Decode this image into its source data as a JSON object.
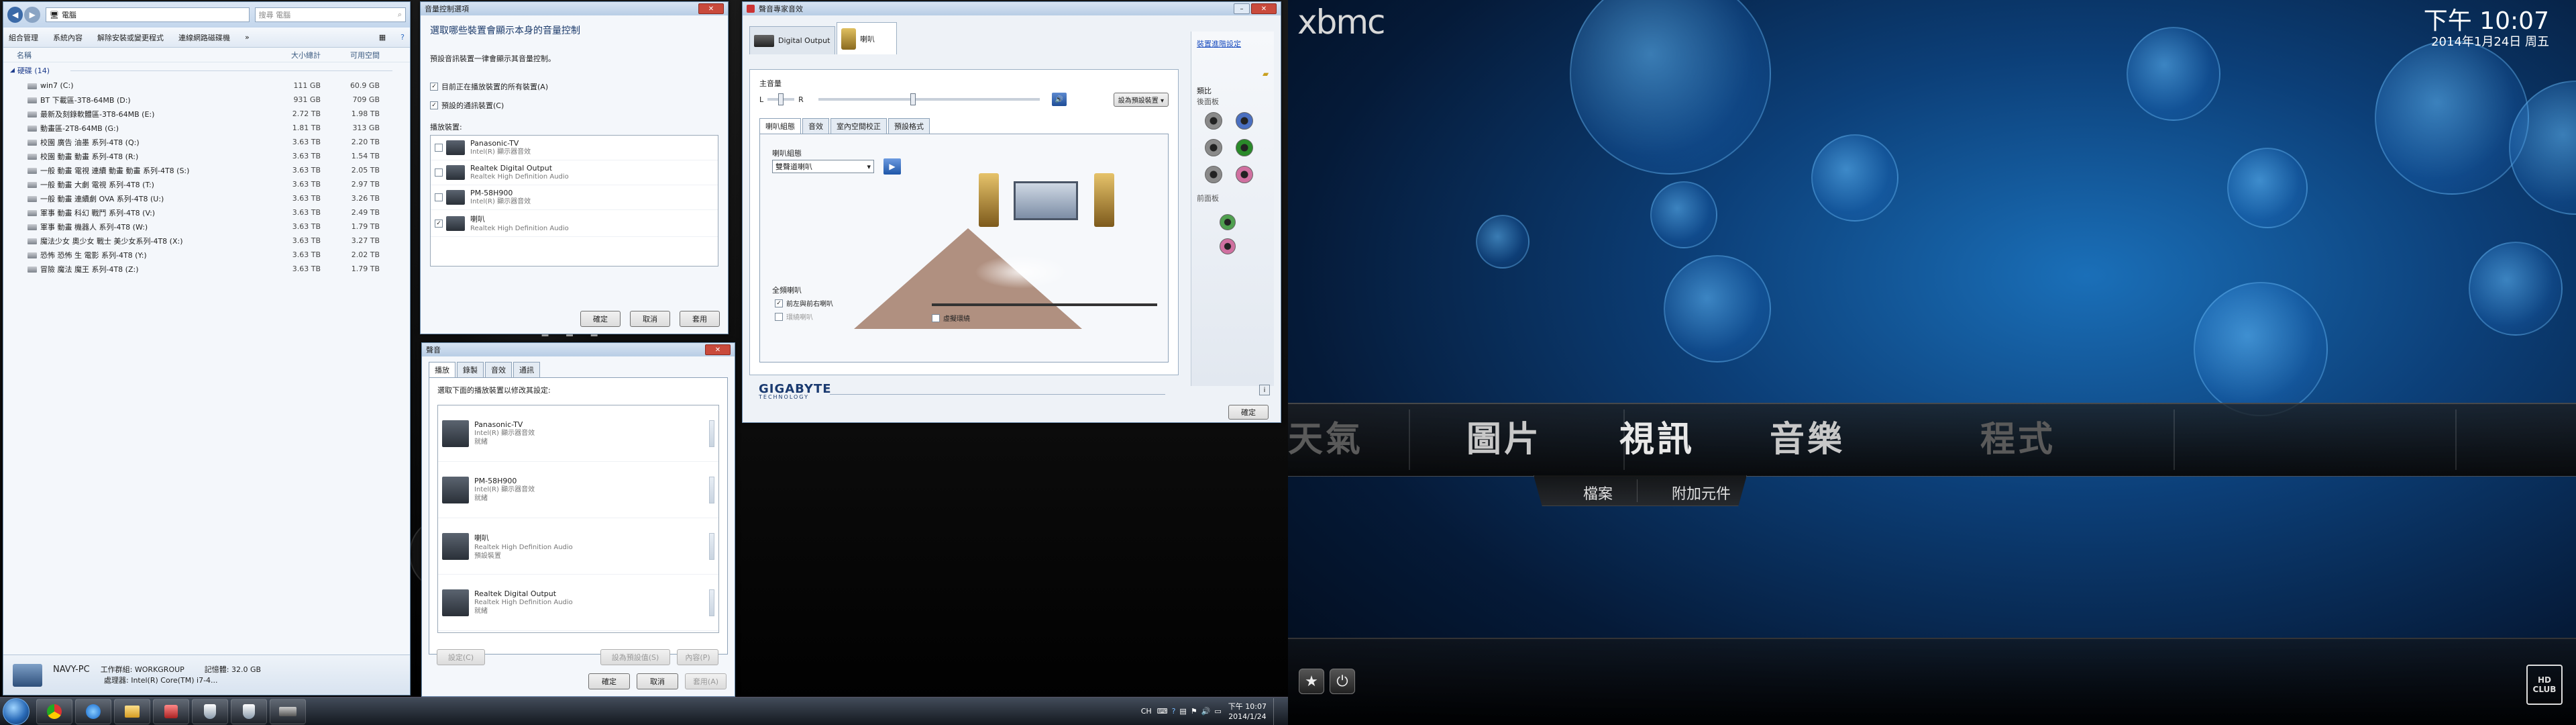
{
  "explorer": {
    "address": "電腦",
    "search_placeholder": "搜尋 電腦",
    "toolbar": [
      "組合管理",
      "系統內容",
      "解除安裝或變更程式",
      "連線網路磁碟機",
      "»"
    ],
    "columns": [
      "名稱",
      "大小總計",
      "可用空間"
    ],
    "group": "硬碟 (14)",
    "drives": [
      {
        "name": "win7 (C:)",
        "total": "111 GB",
        "free": "60.9 GB"
      },
      {
        "name": "BT 下載區-3T8-64MB (D:)",
        "total": "931 GB",
        "free": "709 GB"
      },
      {
        "name": "最新及刻錄軟體區-3T8-64MB (E:)",
        "total": "2.72 TB",
        "free": "1.98 TB"
      },
      {
        "name": "動畫區-2T8-64MB (G:)",
        "total": "1.81 TB",
        "free": "313 GB"
      },
      {
        "name": "校園 廣告 油墨 系列-4T8 (Q:)",
        "total": "3.63 TB",
        "free": "2.20 TB"
      },
      {
        "name": "校園 動畫 動畫 系列-4T8 (R:)",
        "total": "3.63 TB",
        "free": "1.54 TB"
      },
      {
        "name": "一般 動畫 電視 連續 動畫 動畫 系列-4T8 (S:)",
        "total": "3.63 TB",
        "free": "2.05 TB"
      },
      {
        "name": "一般 動畫 大劇 電視 系列-4T8 (T:)",
        "total": "3.63 TB",
        "free": "2.97 TB"
      },
      {
        "name": "一般 動畫 連續劇 OVA 系列-4T8 (U:)",
        "total": "3.63 TB",
        "free": "3.26 TB"
      },
      {
        "name": "軍事 動畫 科幻 戰鬥 系列-4T8 (V:)",
        "total": "3.63 TB",
        "free": "2.49 TB"
      },
      {
        "name": "軍事 動畫 機器人 系列-4T8 (W:)",
        "total": "3.63 TB",
        "free": "1.79 TB"
      },
      {
        "name": "魔法少女 奧少女 戰士 美少女系列-4T8 (X:)",
        "total": "3.63 TB",
        "free": "3.27 TB"
      },
      {
        "name": "恐怖 恐怖 生 電影 系列-4T8 (Y:)",
        "total": "3.63 TB",
        "free": "2.02 TB"
      },
      {
        "name": "冒險 魔法 魔王 系列-4T8 (Z:)",
        "total": "3.63 TB",
        "free": "1.79 TB"
      }
    ],
    "pc_name": "NAVY-PC",
    "workgroup": "工作群組: WORKGROUP",
    "memory": "記憶體: 32.0 GB",
    "cpu": "處理器: Intel(R) Core(TM) i7-4..."
  },
  "vol_dialog": {
    "title": "音量控制選項",
    "heading": "選取哪些裝置會顯示本身的音量控制",
    "desc": "預設音訊裝置一律會顯示其音量控制。",
    "opt1": "目前正在播放裝置的所有裝置(A)",
    "opt2": "預設的通訊裝置(C)",
    "list_label": "播放裝置:",
    "devices": [
      {
        "name": "Panasonic-TV",
        "sub": "Intel(R) 顯示器音效",
        "checked": ""
      },
      {
        "name": "Realtek Digital Output",
        "sub": "Realtek High Definition Audio",
        "checked": ""
      },
      {
        "name": "PM-58H900",
        "sub": "Intel(R) 顯示器音效",
        "checked": ""
      },
      {
        "name": "喇叭",
        "sub": "Realtek High Definition Audio",
        "checked": "✓"
      }
    ],
    "ok": "確定",
    "cancel": "取消",
    "apply": "套用"
  },
  "sound_dialog": {
    "title": "聲音",
    "tabs": [
      "播放",
      "錄製",
      "音效",
      "通訊"
    ],
    "desc": "選取下面的播放裝置以修改其設定:",
    "devices": [
      {
        "name": "Panasonic-TV",
        "sub1": "Intel(R) 顯示器音效",
        "sub2": "就緒"
      },
      {
        "name": "PM-58H900",
        "sub1": "Intel(R) 顯示器音效",
        "sub2": "就緒"
      },
      {
        "name": "喇叭",
        "sub1": "Realtek High Definition Audio",
        "sub2": "預設裝置"
      },
      {
        "name": "Realtek Digital Output",
        "sub1": "Realtek High Definition Audio",
        "sub2": "就緒"
      }
    ],
    "configure": "設定(C)",
    "set_default": "設為預設值(S)",
    "properties": "內容(P)",
    "ok": "確定",
    "cancel": "取消",
    "apply": "套用(A)"
  },
  "audio_manager": {
    "title": "聲音專家音效",
    "tab1": "Digital Output",
    "tab2": "喇叭",
    "advanced_link": "裝置進階設定",
    "main_volume": "主音量",
    "left": "L",
    "right": "R",
    "set_default": "設為預設裝置",
    "subtabs": [
      "喇叭組態",
      "音效",
      "室內空間校正",
      "預設格式"
    ],
    "config_label": "喇叭組態",
    "config_value": "雙聲道喇叭",
    "fullrange_label": "全頻喇叭",
    "fullrange_opt1": "前左與前右喇叭",
    "fullrange_opt2": "環繞喇叭",
    "virtual": "虛擬環繞",
    "analog_label": "類比",
    "back_panel": "後面板",
    "front_panel": "前面板",
    "brand": "GIGABYTE",
    "brand_sub": "TECHNOLOGY",
    "ok": "確定"
  },
  "taskbar": {
    "lang": "CH",
    "time": "下午 10:07",
    "date": "2014/1/24"
  },
  "xbmc": {
    "logo": "xbmc",
    "clock": "下午 10:07",
    "date": "2014年1月24日 周五",
    "menu": [
      "天氣",
      "圖片",
      "視訊",
      "音樂",
      "程式"
    ],
    "submenu": [
      "檔案",
      "附加元件"
    ],
    "club_logo": "HD CLUB"
  }
}
